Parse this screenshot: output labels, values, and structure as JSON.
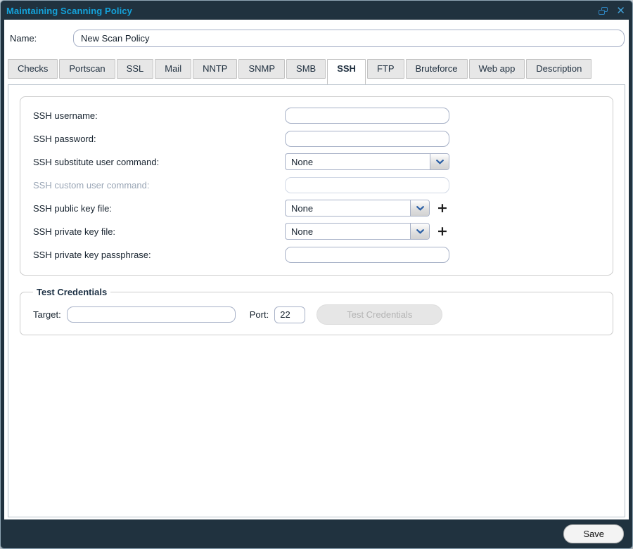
{
  "window": {
    "title": "Maintaining Scanning Policy",
    "icons": {
      "restore": "restore-window",
      "close_glyph": "✕"
    }
  },
  "colors": {
    "titlebar_bg": "#20323f",
    "title_text": "#14a2da",
    "icon_blue": "#2f85c0",
    "input_border": "#a7b1c7",
    "panel_border": "#b7c1cb",
    "chevron_blue": "#2b5fa5"
  },
  "name_field": {
    "label": "Name:",
    "value": "New Scan Policy"
  },
  "tabs": [
    {
      "label": "Checks",
      "active": false
    },
    {
      "label": "Portscan",
      "active": false
    },
    {
      "label": "SSL",
      "active": false
    },
    {
      "label": "Mail",
      "active": false
    },
    {
      "label": "NNTP",
      "active": false
    },
    {
      "label": "SNMP",
      "active": false
    },
    {
      "label": "SMB",
      "active": false
    },
    {
      "label": "SSH",
      "active": true
    },
    {
      "label": "FTP",
      "active": false
    },
    {
      "label": "Bruteforce",
      "active": false
    },
    {
      "label": "Web app",
      "active": false
    },
    {
      "label": "Description",
      "active": false
    }
  ],
  "ssh_form": {
    "fields": [
      {
        "label": "SSH username:",
        "type": "text",
        "value": "",
        "disabled": false
      },
      {
        "label": "SSH password:",
        "type": "text",
        "value": "",
        "disabled": false
      },
      {
        "label": "SSH substitute user command:",
        "type": "select",
        "value": "None",
        "disabled": false
      },
      {
        "label": "SSH custom user command:",
        "type": "text",
        "value": "",
        "disabled": true
      },
      {
        "label": "SSH public key file:",
        "type": "select-add",
        "value": "None",
        "disabled": false
      },
      {
        "label": "SSH private key file:",
        "type": "select-add",
        "value": "None",
        "disabled": false
      },
      {
        "label": "SSH private key passphrase:",
        "type": "text",
        "value": "",
        "disabled": false
      }
    ],
    "add_glyph": "+"
  },
  "test_credentials": {
    "legend": "Test Credentials",
    "target_label": "Target:",
    "target_value": "",
    "port_label": "Port:",
    "port_value": "22",
    "button_label": "Test Credentials"
  },
  "footer": {
    "save_label": "Save"
  }
}
